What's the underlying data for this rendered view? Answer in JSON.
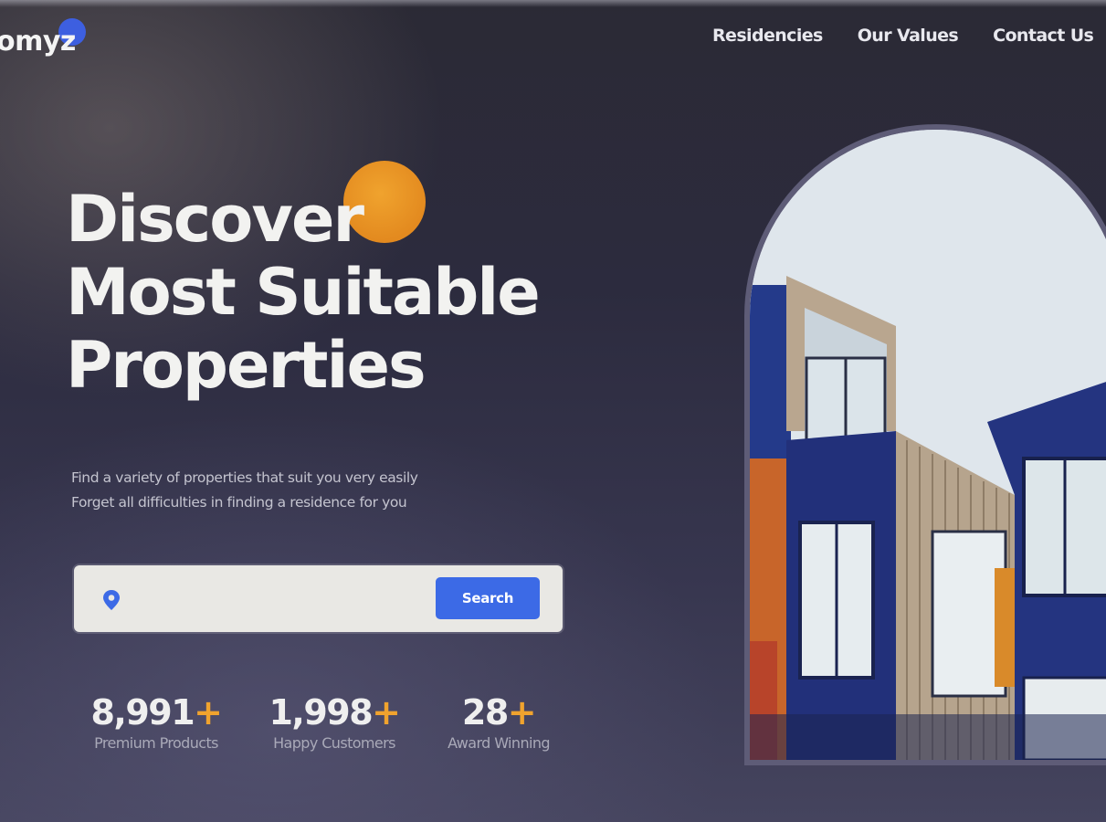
{
  "brand": {
    "logo_text": "omyz",
    "dot_color": "#3d5fe0"
  },
  "nav": {
    "items": [
      "Residencies",
      "Our Values",
      "Contact Us"
    ]
  },
  "hero": {
    "title_lines": [
      "Discover",
      "Most Suitable",
      "Properties"
    ],
    "subtitle_lines": [
      "Find a variety of properties that suit you very easily",
      "Forget all difficulties in finding a residence for you"
    ],
    "accent_color": "#f0a32e"
  },
  "search": {
    "icon": "map-pin-icon",
    "value": "",
    "button_label": "Search",
    "button_color": "#3c6ae6"
  },
  "stats": [
    {
      "value": "8,991",
      "suffix": "+",
      "label": "Premium Products"
    },
    {
      "value": "1,998",
      "suffix": "+",
      "label": "Happy Customers"
    },
    {
      "value": "28",
      "suffix": "+",
      "label": "Award Winning"
    }
  ],
  "hero_image": {
    "description_icon": "building-photo",
    "building_color": "#24306b"
  }
}
